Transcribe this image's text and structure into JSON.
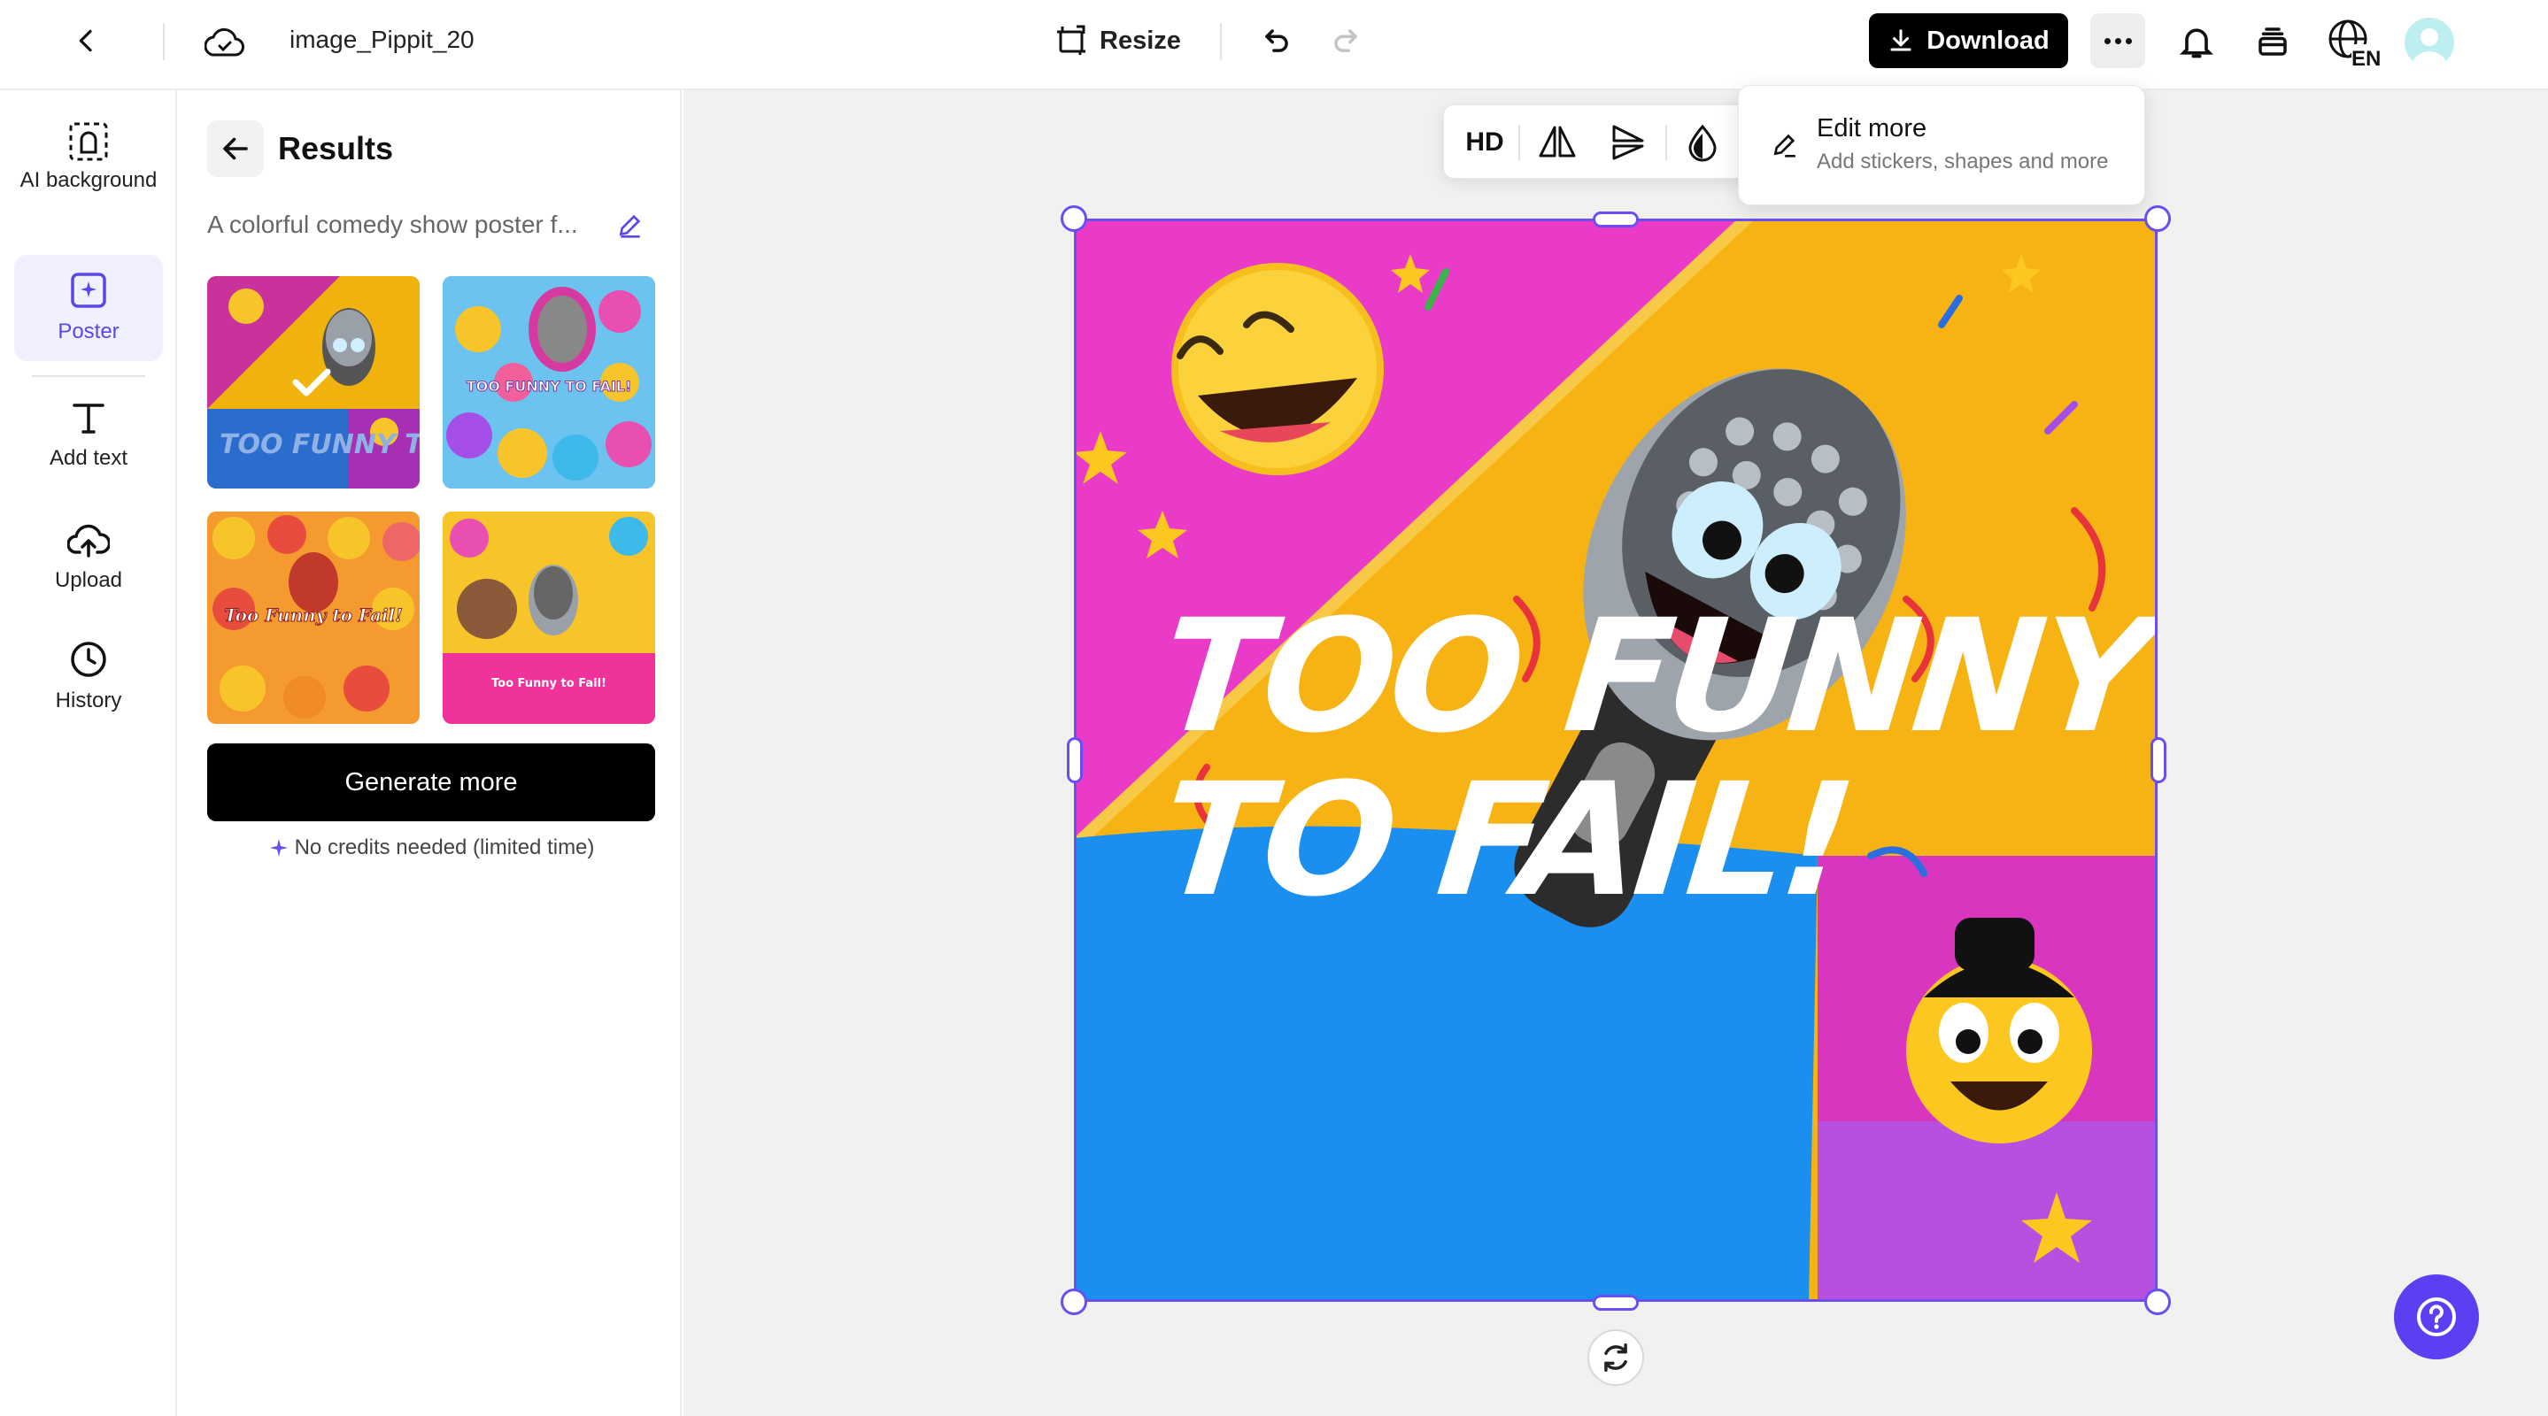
{
  "topbar": {
    "project_name": "image_Pippit_20",
    "resize_label": "Resize",
    "download_label": "Download",
    "language_code": "EN"
  },
  "rail": {
    "items": [
      {
        "label": "AI background",
        "icon": "ai-background-icon"
      },
      {
        "label": "Poster",
        "icon": "poster-icon",
        "active": true
      },
      {
        "label": "Add text",
        "icon": "text-icon"
      },
      {
        "label": "Upload",
        "icon": "upload-icon"
      },
      {
        "label": "History",
        "icon": "history-icon"
      }
    ]
  },
  "results": {
    "title": "Results",
    "prompt": "A colorful comedy show poster f...",
    "thumbnails": [
      {
        "caption": "TOO FUNNY TO FAIL!",
        "selected": true
      },
      {
        "caption": "TOO FUNNY TO FAIL!",
        "selected": false
      },
      {
        "caption": "Too Funny to Fail!",
        "selected": false
      },
      {
        "caption": "Too Funny to Fail!",
        "selected": false
      }
    ],
    "generate_label": "Generate more",
    "credits_note": "No credits needed (limited time)"
  },
  "toolbar": {
    "hd_label": "HD"
  },
  "dropdown": {
    "title": "Edit more",
    "subtitle": "Add stickers, shapes and more"
  },
  "poster": {
    "line1": "TOO FUNNY",
    "line2": "TO FAIL!"
  },
  "colors": {
    "accent": "#6a4ff0",
    "help_button": "#5b3ff0",
    "poster_magenta": "#e93bc8",
    "poster_yellow": "#f6b313",
    "poster_blue": "#1a8ff0"
  }
}
